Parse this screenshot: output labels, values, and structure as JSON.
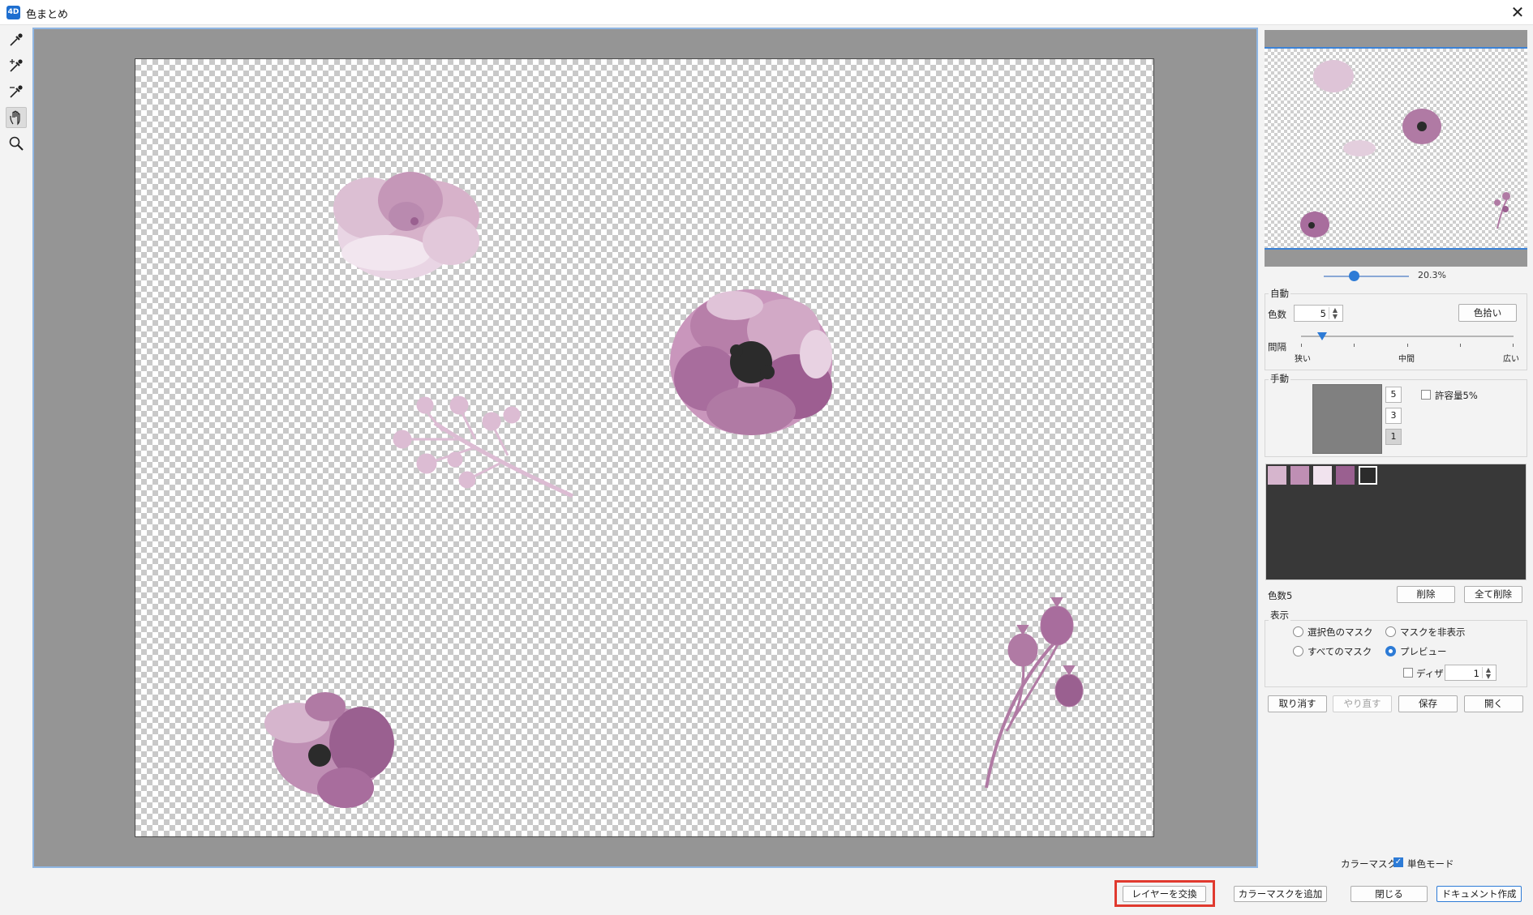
{
  "window": {
    "title": "色まとめ",
    "app_icon_text": "4D",
    "close_glyph": "✕"
  },
  "tools": [
    "eyedropper-icon",
    "eyedropper-plus-icon",
    "eyedropper-minus-icon",
    "hand-icon",
    "zoom-icon"
  ],
  "navigator": {
    "zoom_level": "20.3%",
    "zoom_fraction": 0.35
  },
  "auto": {
    "label": "自動",
    "color_count_label": "色数",
    "color_count_value": "5",
    "pick_button": "色拾い",
    "interval_label": "間隔",
    "interval_ticks": [
      "狭い",
      "中間",
      "広い"
    ],
    "interval_fraction": 0.1
  },
  "manual": {
    "label": "手動",
    "levels": [
      "5",
      "3",
      "1"
    ],
    "selected_level": "1",
    "tolerance_label": "許容量5%",
    "tolerance_checked": false,
    "preview_color": "#808080"
  },
  "palette": {
    "swatches": [
      "#d6b5cd",
      "#bf8fb4",
      "#f1e3ee",
      "#9a6090",
      "#2b2b2b"
    ],
    "count_label": "色数5",
    "delete_button": "削除",
    "delete_all_button": "全て削除",
    "background": "#383838"
  },
  "display": {
    "label": "表示",
    "options": [
      {
        "label": "選択色のマスク",
        "checked": false
      },
      {
        "label": "マスクを非表示",
        "checked": false
      },
      {
        "label": "すべてのマスク",
        "checked": false
      },
      {
        "label": "プレビュー",
        "checked": true
      }
    ],
    "dither_label": "ディザ",
    "dither_checked": false,
    "dither_value": "1"
  },
  "actions": {
    "undo": "取り消す",
    "redo": "やり直す",
    "save": "保存",
    "open": "開く"
  },
  "color_mask": {
    "label": "カラーマスク",
    "mono_label": "単色モード",
    "mono_checked": true
  },
  "footer": {
    "swap_layer": "レイヤーを交換",
    "add_color_mask": "カラーマスクを追加",
    "close": "閉じる",
    "create_document": "ドキュメント作成"
  },
  "colors": {
    "accent": "#2d7bd6",
    "highlight_frame": "#e03a2f"
  }
}
